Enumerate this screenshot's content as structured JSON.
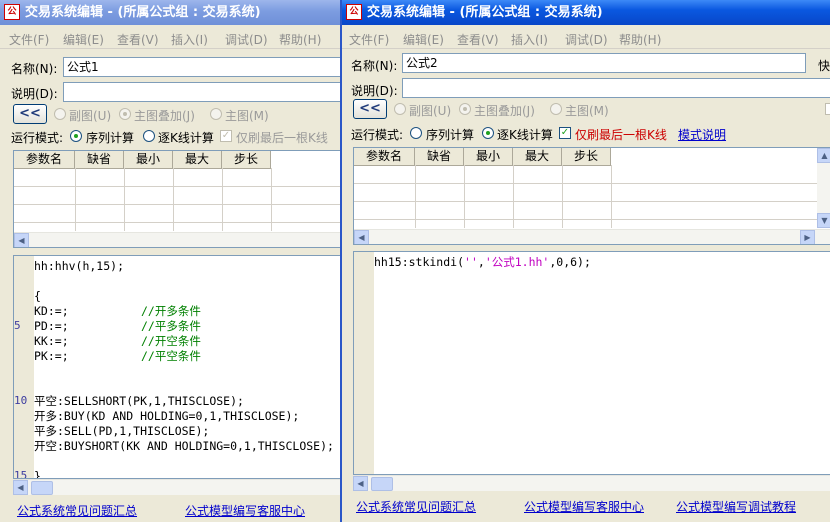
{
  "left_window": {
    "title": "交易系统编辑 - (所属公式组 : 交易系统)",
    "menu": [
      "文件(F)",
      "编辑(E)",
      "查看(V)",
      "插入(I)",
      "调试(D)",
      "帮助(H)"
    ],
    "name_label": "名称(N):",
    "name_value": "公式1",
    "desc_label": "说明(D):",
    "desc_value": "",
    "collapse_button": "<<",
    "chart_options": [
      "副图(U)",
      "主图叠加(J)",
      "主图(M)"
    ],
    "run_mode_label": "运行模式:",
    "mode_seq": "序列计算",
    "mode_kline": "逐K线计算",
    "only_last_label": "仅刷最后一根K线",
    "param_headers": [
      "参数名",
      "缺省",
      "最小",
      "最大",
      "步长"
    ],
    "line_numbers": [
      "5",
      "10",
      "15"
    ],
    "code_lines": [
      {
        "t": "hh:hhv(h,15);",
        "c": ""
      },
      {
        "t": "",
        "c": ""
      },
      {
        "t": "{",
        "c": ""
      },
      {
        "t": "KD:=;",
        "c": "//开多条件"
      },
      {
        "t": "PD:=;",
        "c": "//平多条件"
      },
      {
        "t": "KK:=;",
        "c": "//开空条件"
      },
      {
        "t": "PK:=;",
        "c": "//平空条件"
      },
      {
        "t": "",
        "c": ""
      },
      {
        "t": "",
        "c": ""
      },
      {
        "t": "平空:SELLSHORT(PK,1,THISCLOSE);",
        "c": ""
      },
      {
        "t": "开多:BUY(KD AND HOLDING=0,1,THISCLOSE);",
        "c": ""
      },
      {
        "t": "平多:SELL(PD,1,THISCLOSE);",
        "c": ""
      },
      {
        "t": "开空:BUYSHORT(KK AND HOLDING=0,1,THISCLOSE);",
        "c": ""
      },
      {
        "t": "",
        "c": ""
      },
      {
        "t": "}",
        "c": ""
      }
    ],
    "links": [
      "公式系统常见问题汇总",
      "公式模型编写客服中心"
    ]
  },
  "right_window": {
    "title": "交易系统编辑 - (所属公式组 : 交易系统)",
    "menu": [
      "文件(F)",
      "编辑(E)",
      "查看(V)",
      "插入(I)",
      "调试(D)",
      "帮助(H)"
    ],
    "name_label": "名称(N):",
    "name_value": "公式2",
    "right_cut_label": "快",
    "desc_label": "说明(D):",
    "desc_value": "",
    "collapse_button": "<<",
    "chart_options": [
      "副图(U)",
      "主图叠加(J)",
      "主图(M)"
    ],
    "run_mode_label": "运行模式:",
    "mode_seq": "序列计算",
    "mode_kline": "逐K线计算",
    "only_last_label": "仅刷最后一根K线",
    "mode_help_link": "模式说明",
    "param_headers": [
      "参数名",
      "缺省",
      "最小",
      "最大",
      "步长"
    ],
    "code_prefix": "hh15:stkindi(",
    "code_str1": "''",
    "code_sep": ",",
    "code_str2": "'公式1.hh'",
    "code_suffix": ",0,6);",
    "links": [
      "公式系统常见问题汇总",
      "公式模型编写客服中心",
      "公式模型编写调试教程"
    ]
  },
  "colors": {
    "accent_red": "#cc0000",
    "comment_green": "#008000",
    "string_magenta": "#c000c0",
    "link_blue": "#0000cc"
  }
}
